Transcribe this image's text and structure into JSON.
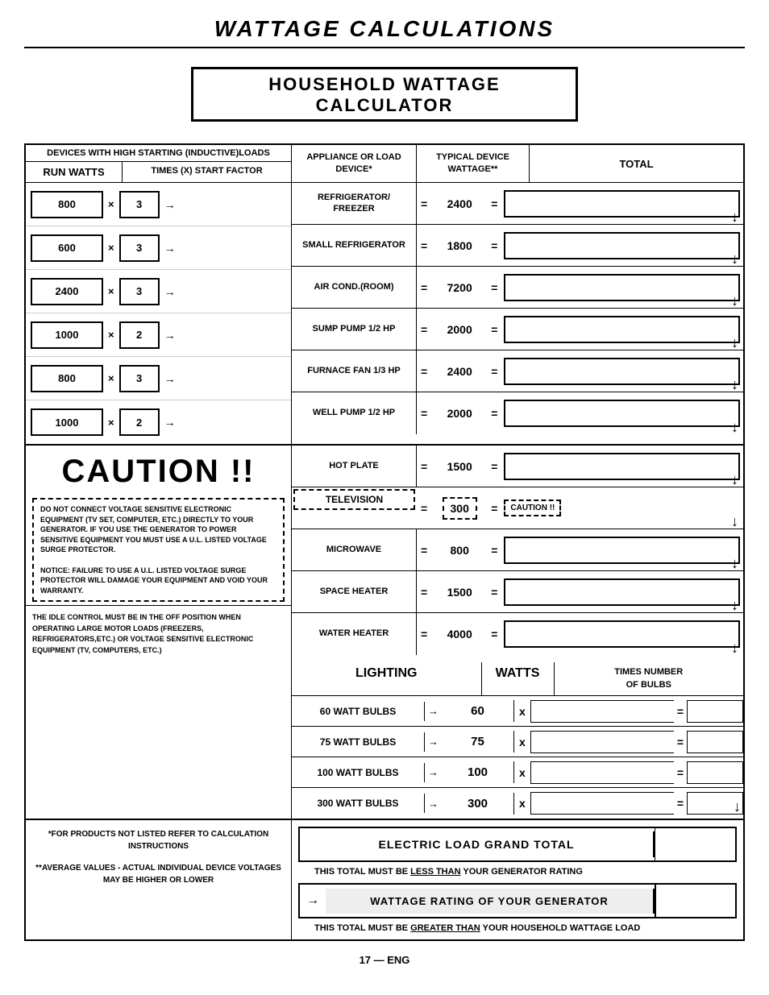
{
  "page": {
    "title": "WATTAGE CALCULATIONS",
    "page_number": "17 — ENG"
  },
  "calculator": {
    "title": "HOUSEHOLD WATTAGE CALCULATOR",
    "headers": {
      "inductive": "DEVICES WITH HIGH STARTING (INDUCTIVE)LOADS",
      "run_watts": "RUN WATTS",
      "times_start": "TIMES (X) START FACTOR",
      "appliance": "APPLIANCE OR LOAD DEVICE*",
      "typical": "TYPICAL DEVICE WATTAGE**",
      "total": "TOTAL"
    },
    "inductive_rows": [
      {
        "run": "800",
        "times": "×",
        "factor": "3"
      },
      {
        "run": "600",
        "times": "×",
        "factor": "3"
      },
      {
        "run": "2400",
        "times": "×",
        "factor": "3"
      },
      {
        "run": "1000",
        "times": "×",
        "factor": "2"
      },
      {
        "run": "800",
        "times": "×",
        "factor": "3"
      },
      {
        "run": "1000",
        "times": "×",
        "factor": "2"
      }
    ],
    "appliance_rows": [
      {
        "name": "REFRIGERATOR/\nFREEZER",
        "eq1": "=",
        "watt": "2400",
        "eq2": "=",
        "is_tv": false
      },
      {
        "name": "SMALL REFRIGERATOR",
        "eq1": "=",
        "watt": "1800",
        "eq2": "=",
        "is_tv": false
      },
      {
        "name": "AIR COND.(ROOM)",
        "eq1": "=",
        "watt": "7200",
        "eq2": "=",
        "is_tv": false
      },
      {
        "name": "SUMP PUMP 1/2 HP",
        "eq1": "=",
        "watt": "2000",
        "eq2": "=",
        "is_tv": false
      },
      {
        "name": "FURNACE FAN 1/3 HP",
        "eq1": "=",
        "watt": "2400",
        "eq2": "=",
        "is_tv": false
      },
      {
        "name": "WELL PUMP 1/2 HP",
        "eq1": "=",
        "watt": "2000",
        "eq2": "=",
        "is_tv": false
      }
    ],
    "caution_rows": [
      {
        "name": "HOT PLATE",
        "eq1": "=",
        "watt": "1500",
        "eq2": "=",
        "is_tv": false
      },
      {
        "name": "TELEVISION",
        "eq1": "=",
        "watt": "300",
        "eq2": "=",
        "is_tv": true,
        "total_label": "CAUTION !!"
      },
      {
        "name": "MICROWAVE",
        "eq1": "=",
        "watt": "800",
        "eq2": "=",
        "is_tv": false
      },
      {
        "name": "SPACE HEATER",
        "eq1": "=",
        "watt": "1500",
        "eq2": "=",
        "is_tv": false
      },
      {
        "name": "WATER HEATER",
        "eq1": "=",
        "watt": "4000",
        "eq2": "=",
        "is_tv": false
      }
    ],
    "caution": {
      "title": "CAUTION !!",
      "dashed_text": "DO NOT CONNECT VOLTAGE SENSITIVE ELECTRONIC EQUIPMENT (TV SET, COMPUTER, ETC.) DIRECTLY TO YOUR GENERATOR. IF YOU USE THE GENERATOR TO POWER SENSITIVE EQUIPMENT YOU MUST USE A U.L. LISTED VOLTAGE SURGE PROTECTOR.\n\nNOTICE: FAILURE TO USE A U.L. LISTED VOLTAGE SURGE PROTECTOR WILL DAMAGE YOUR EQUIPMENT AND VOID YOUR WARRANTY.",
      "idle_text": "THE IDLE CONTROL MUST BE IN THE OFF POSITION WHEN OPERATING LARGE MOTOR LOADS (FREEZERS, REFRIGERATORS,ETC.) OR VOLTAGE SENSITIVE ELECTRONIC EQUIPMENT (TV, COMPUTERS, ETC.)"
    },
    "lighting": {
      "col_label": "LIGHTING",
      "col_watts": "WATTS",
      "col_times": "TIMES NUMBER\nOF BULBS",
      "rows": [
        {
          "name": "60 WATT BULBS",
          "watts": "60"
        },
        {
          "name": "75 WATT BULBS",
          "watts": "75"
        },
        {
          "name": "100 WATT BULBS",
          "watts": "100"
        },
        {
          "name": "300 WATT BULBS",
          "watts": "300"
        }
      ]
    },
    "notes": {
      "note1": "*FOR PRODUCTS NOT LISTED REFER TO CALCULATION INSTRUCTIONS",
      "note2": "**AVERAGE VALUES - ACTUAL INDIVIDUAL DEVICE VOLTAGES MAY BE HIGHER OR LOWER"
    },
    "bottom": {
      "grand_total_label": "ELECTRIC LOAD GRAND TOTAL",
      "sub_note1a": "THIS TOTAL MUST BE",
      "sub_note1b": "LESS THAN",
      "sub_note1c": "YOUR GENERATOR RATING",
      "generator_label": "WATTAGE RATING OF YOUR GENERATOR",
      "sub_note2a": "THIS TOTAL MUST BE",
      "sub_note2b": "GREATER THAN",
      "sub_note2c": "YOUR HOUSEHOLD WATTAGE LOAD"
    }
  }
}
